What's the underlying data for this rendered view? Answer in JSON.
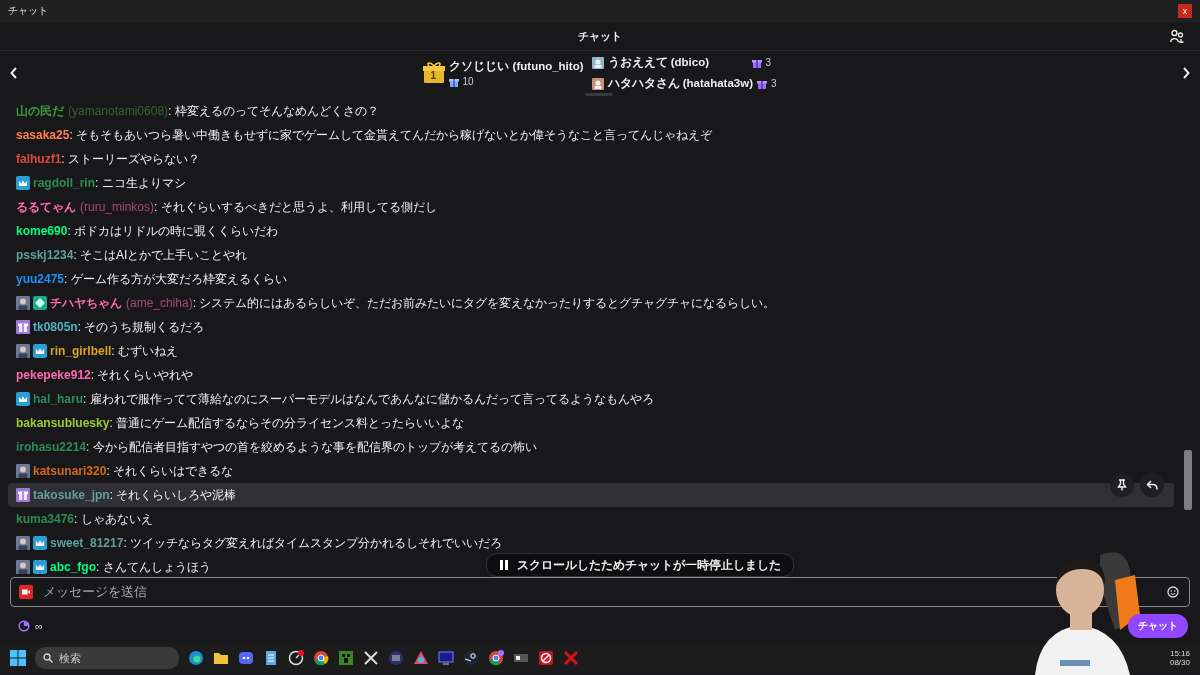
{
  "window": {
    "title": "チャット",
    "close": "x"
  },
  "header": {
    "title": "チャット"
  },
  "gift_leaderboard": {
    "entries": [
      {
        "rank": "1",
        "name": "クソじじい (futuno_hito)",
        "count": "10"
      },
      {
        "name": "うおええて (dbico)",
        "count": "3"
      },
      {
        "name": "ハタハタさん (hatahata3w)",
        "count": "3"
      }
    ]
  },
  "messages": [
    {
      "name": "山の民だ",
      "login": "(yamanotami0608)",
      "color": "#3c9a3c",
      "text": ": 枠変えるのってそんなめんどくさの？",
      "hovered": false
    },
    {
      "name": "sasaka25",
      "color": "#ff7f50",
      "text": ": そもそもあいつら暑い中働きもせずに家でゲームして金貰えてんだから稼げないとか偉そうなこと言ってんじゃねえぞ",
      "hovered": false
    },
    {
      "name": "falhuzf1",
      "color": "#e0483e",
      "text": ": ストーリーズやらない？",
      "hovered": false
    },
    {
      "badges": [
        {
          "kind": "crown"
        }
      ],
      "name": "ragdoll_rin",
      "color": "#2e8b57",
      "text": ": ニコ生よりマシ",
      "hovered": false
    },
    {
      "name": "るるてゃん",
      "login": "(ruru_minkos)",
      "color": "#ff69b4",
      "text": ": それぐらいするべきだと思うよ、利用してる側だし",
      "hovered": false
    },
    {
      "name": "kome690",
      "color": "#00ff7f",
      "text": ": ボドカはリドルの時に覗くくらいだわ",
      "hovered": false
    },
    {
      "name": "psskj1234",
      "color": "#5f9ea0",
      "text": ": そこはAIとかで上手いことやれ",
      "hovered": false
    },
    {
      "name": "yuu2475",
      "color": "#1e90ff",
      "text": ": ゲーム作る方が大変だろ枠変えるくらい",
      "hovered": false
    },
    {
      "badges": [
        {
          "kind": "avatar"
        },
        {
          "kind": "gem"
        }
      ],
      "name": "チハヤちゃん",
      "login": "(ame_chiha)",
      "color": "#ff69b4",
      "text": ": システム的にはあるらしいぞ、ただお前みたいにタグを変えなかったりするとグチャグチャになるらしい。",
      "hovered": false
    },
    {
      "badges": [
        {
          "kind": "gift"
        }
      ],
      "name": "tk0805n",
      "color": "#4fb0c6",
      "text": ": そのうち規制くるだろ",
      "hovered": false
    },
    {
      "badges": [
        {
          "kind": "avatar"
        },
        {
          "kind": "crown"
        }
      ],
      "name": "rin_girlbell",
      "color": "#daa520",
      "text": ": むずいねえ",
      "hovered": false
    },
    {
      "name": "pekepeke912",
      "color": "#ff69b4",
      "text": ": それくらいやれや",
      "hovered": false
    },
    {
      "badges": [
        {
          "kind": "crown"
        }
      ],
      "name": "hal_haru",
      "color": "#2e8b57",
      "text": ": 雇われで服作ってて薄給なのにスーパーモデルはなんであんなに儲かるんだって言ってるようなもんやろ",
      "hovered": false
    },
    {
      "name": "bakansubluesky",
      "color": "#9acd32",
      "text": ": 普通にゲーム配信するならその分ライセンス料とったらいいよな",
      "hovered": false
    },
    {
      "name": "irohasu2214",
      "color": "#2e8b57",
      "text": ": 今から配信者目指すやつの首を絞めるような事を配信界のトップが考えてるの怖い",
      "hovered": false
    },
    {
      "badges": [
        {
          "kind": "avatar"
        }
      ],
      "name": "katsunari320",
      "color": "#d2691e",
      "text": ": それくらいはできるな",
      "hovered": false
    },
    {
      "badges": [
        {
          "kind": "gift"
        }
      ],
      "name": "takosuke_jpn",
      "color": "#5f9ea0",
      "text": ": それくらいしろや泥棒",
      "hovered": true
    },
    {
      "name": "kuma3476",
      "color": "#2e8b57",
      "text": ": しゃあないえ",
      "hovered": false
    },
    {
      "badges": [
        {
          "kind": "avatar"
        },
        {
          "kind": "crown"
        }
      ],
      "name": "sweet_81217",
      "color": "#5f9ea0",
      "text": ": ツイッチならタグ変えればタイムスタンプ分かれるしそれでいいだろ",
      "hovered": false
    },
    {
      "badges": [
        {
          "kind": "avatar"
        },
        {
          "kind": "crown"
        }
      ],
      "name": "abc_fgo",
      "color": "#00ff7f",
      "text": ": さんてんしょうほう",
      "hovered": false
    }
  ],
  "paused_notice": "スクロールしたためチャットが一時停止しました",
  "input": {
    "placeholder": "メッセージを送信"
  },
  "points": {
    "value": "∞"
  },
  "chat_button": "チャット",
  "taskbar": {
    "search_placeholder": "検索",
    "time": "15:16",
    "date": "08/30"
  }
}
